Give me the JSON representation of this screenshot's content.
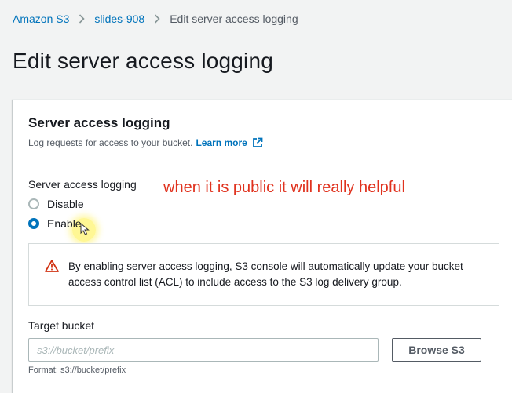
{
  "breadcrumb": {
    "root": "Amazon S3",
    "bucket": "slides-908",
    "current": "Edit server access logging"
  },
  "page": {
    "title": "Edit server access logging"
  },
  "panel": {
    "title": "Server access logging",
    "description": "Log requests for access to your bucket.",
    "learn_more": "Learn more",
    "field_label": "Server access logging",
    "options": [
      {
        "label": "Disable",
        "selected": false
      },
      {
        "label": "Enable",
        "selected": true
      }
    ],
    "annotation": "when it is public it will really helpful",
    "alert": {
      "text": "By enabling server access logging, S3 console will automatically update your bucket access control list (ACL) to include access to the S3 log delivery group."
    },
    "target_bucket": {
      "label": "Target bucket",
      "placeholder": "s3://bucket/prefix",
      "value": "",
      "browse_label": "Browse S3",
      "format_hint": "Format: s3://bucket/prefix"
    }
  },
  "colors": {
    "link": "#0073bb",
    "warning": "#d13212",
    "annotation": "#e0321e",
    "page_bg": "#f2f3f3"
  },
  "icons": [
    "chevron-right-icon",
    "external-link-icon",
    "warning-icon",
    "cursor-icon"
  ]
}
